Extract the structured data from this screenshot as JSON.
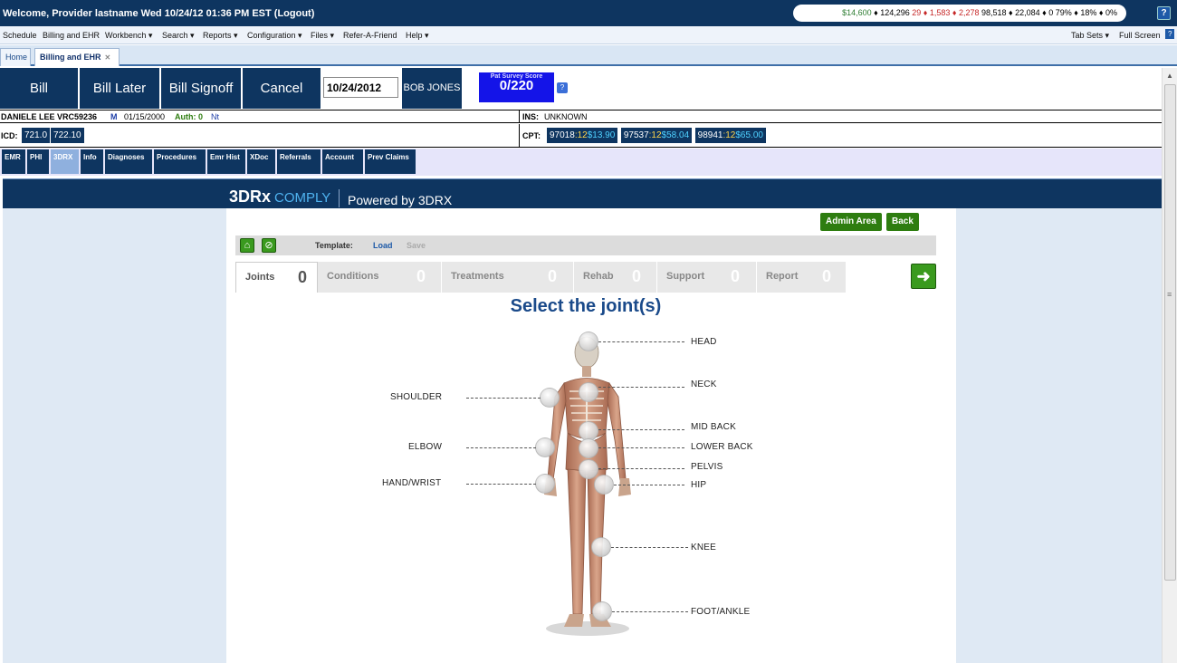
{
  "topbar": {
    "welcome": "Welcome, Provider lastname   Wed 10/24/12 01:36 PM EST   (Logout)",
    "stats_green_1": "$14,600",
    "stats_part_1": " ♦ 124,296  ",
    "stats_red_1": "29 ♦ 1,583 ♦ 2,278",
    "stats_part_2": "  98,518 ♦ 22,084 ♦ 0  79% ♦ 18% ♦ 0%",
    "help_label": "?"
  },
  "menu": {
    "items": [
      "Schedule",
      "Billing and EHR",
      "Workbench ▾",
      "Search ▾",
      "Reports ▾",
      "Configuration ▾",
      "Files ▾",
      "Refer-A-Friend",
      "Help ▾"
    ],
    "tab_sets": "Tab Sets ▾",
    "full_screen": "Full Screen",
    "help_label": "?"
  },
  "page_tabs": {
    "home": "Home",
    "billing": "Billing and EHR"
  },
  "actions": {
    "bill": "Bill",
    "bill_later": "Bill Later",
    "bill_signoff": "Bill Signoff",
    "cancel": "Cancel",
    "date": "10/24/2012",
    "patient_button": "BOB JONES",
    "survey_label": "Pat Survey Score",
    "survey_value": "0/220",
    "survey_help": "?"
  },
  "patient": {
    "name_id": "DANIELE LEE  VRC59236",
    "sex": "M",
    "dob": "01/15/2000",
    "auth": "Auth: 0",
    "nt": "Nt",
    "ins_label": "INS:",
    "ins_value": "UNKNOWN"
  },
  "codes": {
    "icd_label": "ICD:",
    "icd": [
      "721.0",
      "722.10"
    ],
    "cpt_label": "CPT:",
    "cpt": [
      {
        "code": "97018",
        "units": ":12",
        "amount": "$13.90"
      },
      {
        "code": "97537",
        "units": ":12",
        "amount": "$58.04"
      },
      {
        "code": "98941",
        "units": ":12",
        "amount": "$65.00"
      }
    ]
  },
  "subtabs": [
    "EMR",
    "PHI",
    "3DRX",
    "Info",
    "Diagnoses",
    "Procedures",
    "Emr Hist",
    "XDoc",
    "Referrals",
    "Account",
    "Prev Claims"
  ],
  "app": {
    "logo_main": "3DRx",
    "logo_comply": "COMPLY",
    "powered": "Powered by 3DRX",
    "admin_area": "Admin Area",
    "back": "Back",
    "template_label": "Template:",
    "load": "Load",
    "save": "Save",
    "wizard_tabs": [
      {
        "label": "Joints",
        "count": "0"
      },
      {
        "label": "Conditions",
        "count": "0"
      },
      {
        "label": "Treatments",
        "count": "0"
      },
      {
        "label": "Rehab",
        "count": "0"
      },
      {
        "label": "Support",
        "count": "0"
      },
      {
        "label": "Report",
        "count": "0"
      }
    ],
    "heading": "Select the joint(s)"
  },
  "joints": {
    "head": "HEAD",
    "neck": "NECK",
    "shoulder": "SHOULDER",
    "mid_back": "MID BACK",
    "elbow": "ELBOW",
    "lower_back": "LOWER BACK",
    "pelvis": "PELVIS",
    "hand_wrist": "HAND/WRIST",
    "hip": "HIP",
    "knee": "KNEE",
    "foot_ankle": "FOOT/ANKLE"
  },
  "colors": {
    "navy": "#0e3560",
    "survey_blue": "#1414e8",
    "green_button": "#2e7d10",
    "heading_blue": "#1a4a8a"
  }
}
